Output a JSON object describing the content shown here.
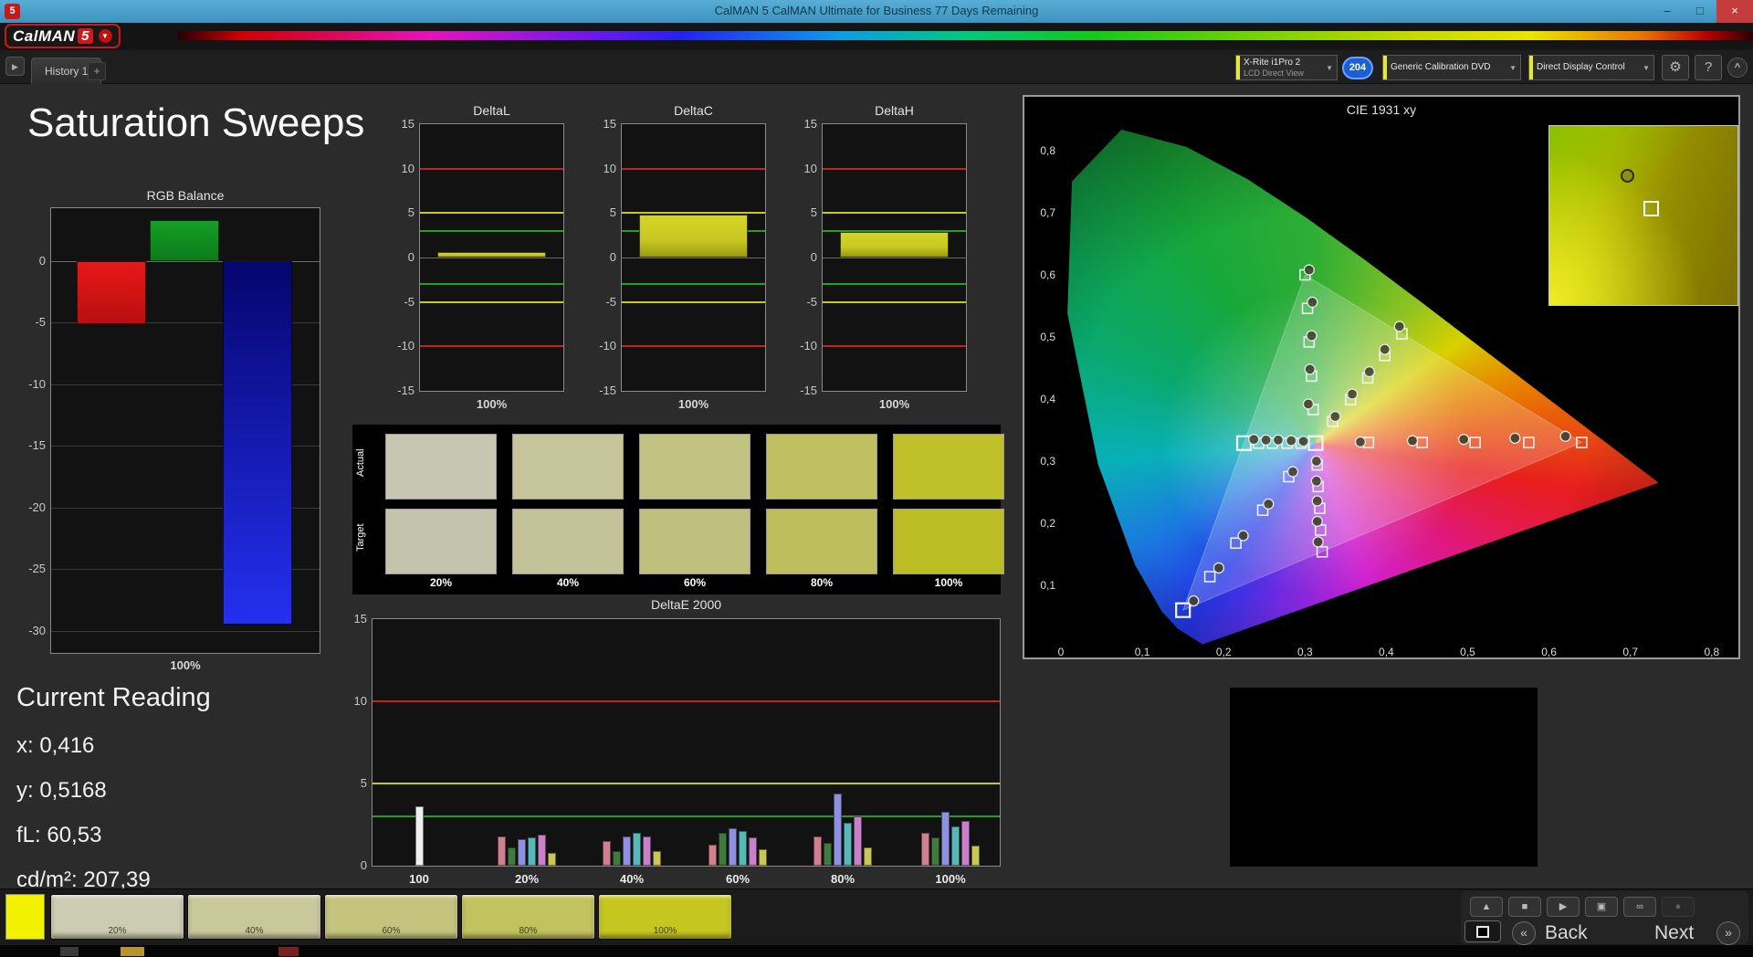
{
  "window": {
    "title": "CalMAN 5 CalMAN Ultimate for Business 77 Days Remaining",
    "app_icon": "5",
    "controls": {
      "minimize": "–",
      "maximize": "□",
      "close": "×"
    }
  },
  "brand": {
    "logo_text": "CalMAN",
    "logo_number": "5",
    "caret": "▼"
  },
  "tabs": {
    "expand_arrow": "▶",
    "history_tab": "History 1",
    "add_tab": "+"
  },
  "toolbar": {
    "meter": {
      "line1": "X-Rite i1Pro 2",
      "line2": "LCD Direct View"
    },
    "badge": "204",
    "source": "Generic Calibration DVD",
    "display_control": "Direct Display Control",
    "chevron": "▼",
    "gear": "⚙",
    "help": "?",
    "collapse": "^"
  },
  "page": {
    "title": "Saturation Sweeps"
  },
  "current_reading": {
    "heading": "Current Reading",
    "x": "x: 0,416",
    "y": "y: 0,5168",
    "fl": "fL: 60,53",
    "cdm2": "cd/m²: 207,39"
  },
  "transport": {
    "eject": "▲",
    "stop": "■",
    "play": "▶",
    "pattern": "▣",
    "loop": "∞",
    "record": "●"
  },
  "buttons": {
    "prev_icon": "«",
    "back": "Back",
    "next": "Next",
    "next_icon": "»"
  },
  "chart_data": [
    {
      "id": "rgb_balance",
      "type": "bar",
      "title": "RGB Balance",
      "xlabel": "100%",
      "categories": [
        "Red",
        "Green",
        "Blue"
      ],
      "values": [
        -5.1,
        3.3,
        -29.5
      ],
      "colors_top": [
        "#e81818",
        "#15a026",
        "#05056e"
      ],
      "colors_bottom": [
        "#b80f0f",
        "#0c7a1a",
        "#2430f0"
      ],
      "ylim": [
        -31.8,
        4.3
      ],
      "yticks": [
        0,
        -5,
        -10,
        -15,
        -20,
        -25,
        -30
      ]
    },
    {
      "id": "deltaL",
      "type": "bar",
      "title": "DeltaL",
      "xlabel": "100%",
      "categories": [
        "100%"
      ],
      "values": [
        0.6
      ],
      "bar_color": "#c8c822",
      "ylim": [
        -15,
        15
      ],
      "yticks": [
        15,
        10,
        5,
        0,
        -5,
        -10,
        -15
      ],
      "limit_lines": [
        {
          "value": 10,
          "color": "#c22222"
        },
        {
          "value": 5,
          "color": "#c8c822"
        },
        {
          "value": 3,
          "color": "#22a022"
        },
        {
          "value": -3,
          "color": "#22a022"
        },
        {
          "value": -5,
          "color": "#c8c822"
        },
        {
          "value": -10,
          "color": "#c22222"
        }
      ]
    },
    {
      "id": "deltaC",
      "type": "bar",
      "title": "DeltaC",
      "xlabel": "100%",
      "categories": [
        "100%"
      ],
      "values": [
        4.8
      ],
      "bar_color": "#c8c822",
      "ylim": [
        -15,
        15
      ],
      "yticks": [
        15,
        10,
        5,
        0,
        -5,
        -10,
        -15
      ],
      "limit_lines": [
        {
          "value": 10,
          "color": "#c22222"
        },
        {
          "value": 5,
          "color": "#c8c822"
        },
        {
          "value": 3,
          "color": "#22a022"
        },
        {
          "value": -3,
          "color": "#22a022"
        },
        {
          "value": -5,
          "color": "#c8c822"
        },
        {
          "value": -10,
          "color": "#c22222"
        }
      ]
    },
    {
      "id": "deltaH",
      "type": "bar",
      "title": "DeltaH",
      "xlabel": "100%",
      "categories": [
        "100%"
      ],
      "values": [
        2.9
      ],
      "bar_color": "#c8c822",
      "ylim": [
        -15,
        15
      ],
      "yticks": [
        15,
        10,
        5,
        0,
        -5,
        -10,
        -15
      ],
      "limit_lines": [
        {
          "value": 10,
          "color": "#c22222"
        },
        {
          "value": 5,
          "color": "#c8c822"
        },
        {
          "value": 3,
          "color": "#22a022"
        },
        {
          "value": -3,
          "color": "#22a022"
        },
        {
          "value": -5,
          "color": "#c8c822"
        },
        {
          "value": -10,
          "color": "#c22222"
        }
      ]
    },
    {
      "id": "saturation_swatches",
      "type": "table",
      "row_labels": [
        "Actual",
        "Target"
      ],
      "columns": [
        "20%",
        "40%",
        "60%",
        "80%",
        "100%"
      ],
      "actual_colors": [
        "#c6c6b2",
        "#c6c49a",
        "#c2c282",
        "#c0c062",
        "#c0c02a"
      ],
      "target_colors": [
        "#c4c4ae",
        "#c4c298",
        "#c0c07e",
        "#bebe5e",
        "#bcbc24"
      ]
    },
    {
      "id": "deltae2000",
      "type": "bar",
      "title": "DeltaE 2000",
      "ylim": [
        0,
        15
      ],
      "yticks": [
        15,
        10,
        5,
        0
      ],
      "limit_lines": [
        {
          "value": 10,
          "color": "#c22222"
        },
        {
          "value": 5,
          "color": "#c8c822"
        },
        {
          "value": 3,
          "color": "#22a022"
        }
      ],
      "groups": [
        {
          "label": "100",
          "bars": [
            {
              "color": "#f0f0f0",
              "value": 3.6
            }
          ]
        },
        {
          "label": "20%",
          "bars": [
            {
              "color": "#d08090",
              "value": 1.8
            },
            {
              "color": "#3f7a3f",
              "value": 1.1
            },
            {
              "color": "#9090e0",
              "value": 1.6
            },
            {
              "color": "#58b8b8",
              "value": 1.7
            },
            {
              "color": "#c880c8",
              "value": 1.9
            },
            {
              "color": "#c8c858",
              "value": 0.8
            }
          ]
        },
        {
          "label": "40%",
          "bars": [
            {
              "color": "#d08090",
              "value": 1.5
            },
            {
              "color": "#3f7a3f",
              "value": 0.9
            },
            {
              "color": "#9090e0",
              "value": 1.8
            },
            {
              "color": "#58b8b8",
              "value": 2.0
            },
            {
              "color": "#c880c8",
              "value": 1.8
            },
            {
              "color": "#c8c858",
              "value": 0.9
            }
          ]
        },
        {
          "label": "60%",
          "bars": [
            {
              "color": "#d08090",
              "value": 1.3
            },
            {
              "color": "#3f7a3f",
              "value": 2.0
            },
            {
              "color": "#9090e0",
              "value": 2.3
            },
            {
              "color": "#58b8b8",
              "value": 2.1
            },
            {
              "color": "#c880c8",
              "value": 1.7
            },
            {
              "color": "#c8c858",
              "value": 1.0
            }
          ]
        },
        {
          "label": "80%",
          "bars": [
            {
              "color": "#d08090",
              "value": 1.8
            },
            {
              "color": "#3f7a3f",
              "value": 1.4
            },
            {
              "color": "#9090e0",
              "value": 4.4
            },
            {
              "color": "#58b8b8",
              "value": 2.6
            },
            {
              "color": "#c880c8",
              "value": 3.0
            },
            {
              "color": "#c8c858",
              "value": 1.1
            }
          ]
        },
        {
          "label": "100%",
          "bars": [
            {
              "color": "#d08090",
              "value": 2.0
            },
            {
              "color": "#3f7a3f",
              "value": 1.7
            },
            {
              "color": "#9090e0",
              "value": 3.3
            },
            {
              "color": "#58b8b8",
              "value": 2.4
            },
            {
              "color": "#c880c8",
              "value": 2.7
            },
            {
              "color": "#c8c858",
              "value": 1.2
            }
          ]
        }
      ]
    },
    {
      "id": "cie",
      "type": "scatter",
      "title": "CIE 1931 xy",
      "xlim": [
        0,
        0.8
      ],
      "ylim": [
        0,
        0.85
      ],
      "xticks": [
        "0",
        "0,1",
        "0,2",
        "0,3",
        "0,4",
        "0,5",
        "0,6",
        "0,7",
        "0,8"
      ],
      "yticks": [
        "0,1",
        "0,2",
        "0,3",
        "0,4",
        "0,5",
        "0,6",
        "0,7",
        "0,8"
      ],
      "gamut_triangle": [
        [
          0.64,
          0.33
        ],
        [
          0.3,
          0.6
        ],
        [
          0.15,
          0.06
        ]
      ],
      "white_point": [
        0.313,
        0.329
      ],
      "current": [
        0.416,
        0.5168
      ],
      "targets": [
        [
          0.313,
          0.329,
          "big"
        ],
        [
          0.378,
          0.33
        ],
        [
          0.444,
          0.33
        ],
        [
          0.509,
          0.33
        ],
        [
          0.575,
          0.33
        ],
        [
          0.64,
          0.33
        ],
        [
          0.31,
          0.383
        ],
        [
          0.308,
          0.437
        ],
        [
          0.305,
          0.492
        ],
        [
          0.303,
          0.546
        ],
        [
          0.3,
          0.6
        ],
        [
          0.28,
          0.275
        ],
        [
          0.248,
          0.221
        ],
        [
          0.215,
          0.168
        ],
        [
          0.183,
          0.114
        ],
        [
          0.15,
          0.06,
          "big"
        ],
        [
          0.295,
          0.329
        ],
        [
          0.278,
          0.329
        ],
        [
          0.26,
          0.329
        ],
        [
          0.243,
          0.329
        ],
        [
          0.225,
          0.329,
          "big"
        ],
        [
          0.315,
          0.294
        ],
        [
          0.316,
          0.259
        ],
        [
          0.318,
          0.224
        ],
        [
          0.319,
          0.189
        ],
        [
          0.321,
          0.154
        ],
        [
          0.334,
          0.364
        ],
        [
          0.356,
          0.399
        ],
        [
          0.377,
          0.434
        ],
        [
          0.398,
          0.47
        ],
        [
          0.419,
          0.505
        ]
      ],
      "measurements": [
        [
          0.368,
          0.331
        ],
        [
          0.432,
          0.333
        ],
        [
          0.495,
          0.335
        ],
        [
          0.558,
          0.337
        ],
        [
          0.62,
          0.34
        ],
        [
          0.304,
          0.392
        ],
        [
          0.306,
          0.448
        ],
        [
          0.308,
          0.502
        ],
        [
          0.309,
          0.556
        ],
        [
          0.305,
          0.608
        ],
        [
          0.285,
          0.283
        ],
        [
          0.255,
          0.231
        ],
        [
          0.224,
          0.18
        ],
        [
          0.194,
          0.128
        ],
        [
          0.163,
          0.075
        ],
        [
          0.298,
          0.332
        ],
        [
          0.283,
          0.333
        ],
        [
          0.267,
          0.334
        ],
        [
          0.252,
          0.334
        ],
        [
          0.237,
          0.335
        ],
        [
          0.314,
          0.3
        ],
        [
          0.314,
          0.268
        ],
        [
          0.315,
          0.236
        ],
        [
          0.315,
          0.203
        ],
        [
          0.316,
          0.17
        ],
        [
          0.337,
          0.372
        ],
        [
          0.358,
          0.408
        ],
        [
          0.379,
          0.444
        ],
        [
          0.398,
          0.48
        ],
        [
          0.416,
          0.517
        ]
      ]
    },
    {
      "id": "bottom_swatches",
      "type": "table",
      "labels": [
        "20%",
        "40%",
        "60%",
        "80%",
        "100%"
      ],
      "colors": [
        "#ccccb2",
        "#c8c89a",
        "#c4c47e",
        "#c2c25e",
        "#c6c620"
      ],
      "current_color": "#f2f200"
    }
  ]
}
